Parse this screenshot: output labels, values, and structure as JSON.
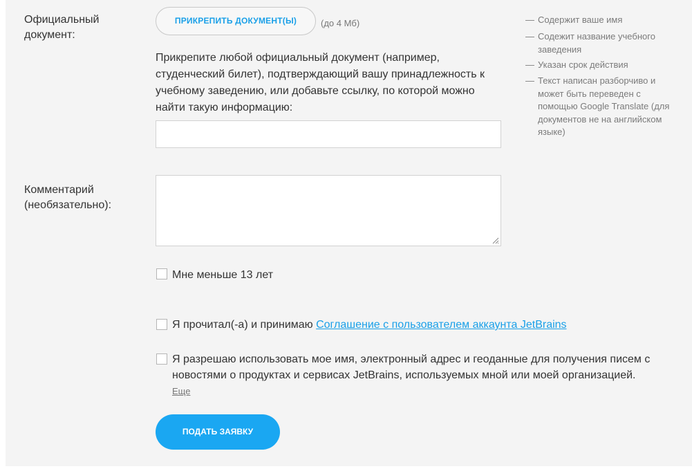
{
  "document": {
    "label": "Официальный документ:",
    "attach_button": "ПРИКРЕПИТЬ ДОКУМЕНТ(Ы)",
    "size_note": "(до 4 Мб)",
    "description": "Прикрепите любой официальный документ (например, студенческий билет), подтверждающий вашу принадлежность к учебному заведению, или добавьте ссылку, по которой можно найти такую информацию:",
    "link_value": ""
  },
  "hints": [
    {
      "dash": "—",
      "text": "Содержит ваше имя"
    },
    {
      "dash": "—",
      "text": "Содежит название учебного заведения"
    },
    {
      "dash": "—",
      "text": "Указан срок действия"
    },
    {
      "dash": "—",
      "text": "Текст написан разборчиво и может быть переведен с помощью Google Translate (для документов не на английском языке)"
    }
  ],
  "comment": {
    "label": "Комментарий (необязательно):",
    "value": ""
  },
  "checkboxes": {
    "age": {
      "label": "Мне меньше 13 лет",
      "checked": false
    },
    "agreement": {
      "prefix": "Я прочитал(-а) и принимаю ",
      "link": "Соглашение с пользователем аккаунта JetBrains",
      "checked": false
    },
    "newsletter": {
      "label": "Я разрешаю использовать мое имя, электронный адрес и геоданные для получения писем с новостями о продуктах и сервисах JetBrains, используемых мной или моей организацией.",
      "more": "Еще",
      "checked": false
    }
  },
  "submit_button": "ПОДАТЬ ЗАЯВКУ"
}
